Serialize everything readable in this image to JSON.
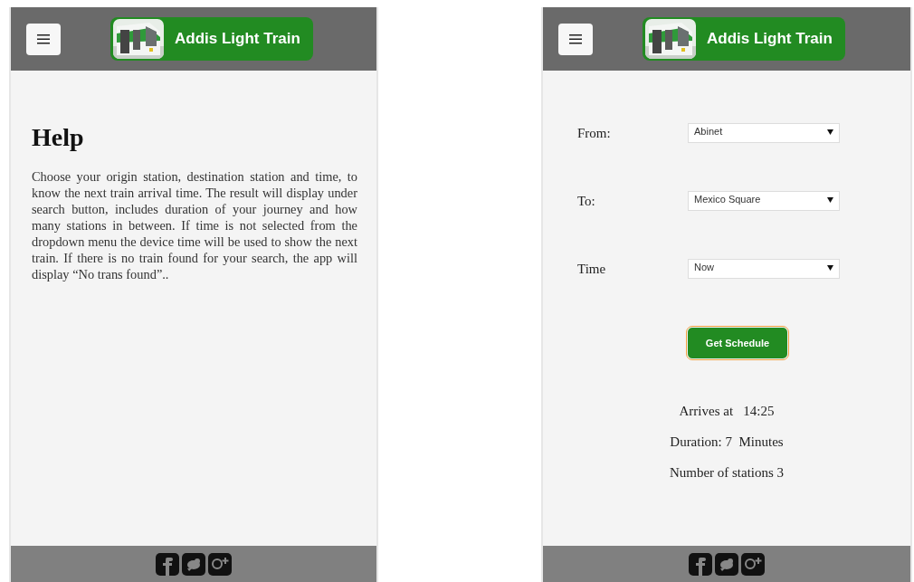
{
  "screens": [
    {
      "kind": "help",
      "header": {
        "title": "Addis Light Train"
      },
      "heading": "Help",
      "body": "Choose your origin station, destination station and time, to know the next train arrival time. The result will display under search button, includes duration of your journey and how many stations in between. If time is not selected from the dropdown menu the device time will be used to show the next train. If there is no train found for your search, the app will display “No trans found”.."
    },
    {
      "kind": "schedule",
      "header": {
        "title": "Addis Light Train"
      },
      "fields": [
        {
          "label": "From:",
          "value": "Abinet"
        },
        {
          "label": "To:",
          "value": "Mexico Square"
        },
        {
          "label": "Time",
          "value": "Now"
        }
      ],
      "button": {
        "label": "Get Schedule",
        "focused": true
      },
      "results": [
        "Arrives at   14:25",
        "Duration: 7  Minutes",
        "Number of stations 3"
      ]
    }
  ]
}
